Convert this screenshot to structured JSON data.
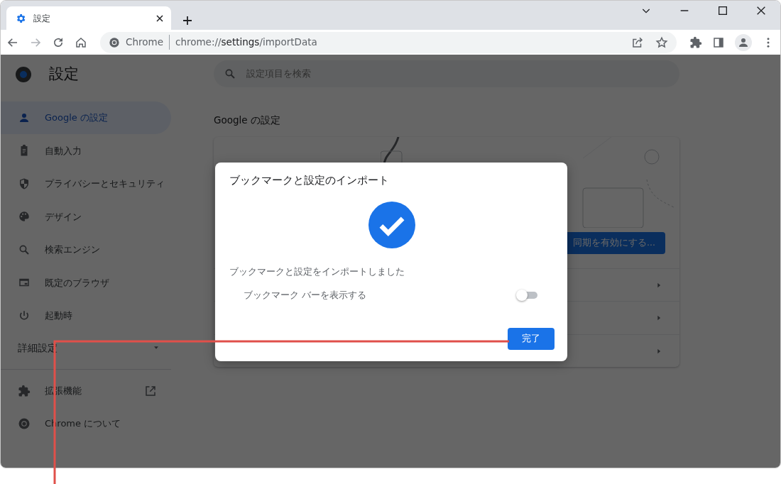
{
  "browser": {
    "tab": {
      "title": "設定",
      "selected": true
    },
    "address": {
      "site": "Chrome",
      "scheme": "chrome://",
      "host": "settings",
      "path": "/importData"
    }
  },
  "sidebar": {
    "title": "設定",
    "items": [
      {
        "label": "Google の設定",
        "selected": true
      },
      {
        "label": "自動入力",
        "selected": false
      },
      {
        "label": "プライバシーとセキュリティ",
        "selected": false
      },
      {
        "label": "デザイン",
        "selected": false
      },
      {
        "label": "検索エンジン",
        "selected": false
      },
      {
        "label": "既定のブラウザ",
        "selected": false
      },
      {
        "label": "起動時",
        "selected": false
      }
    ],
    "advanced": {
      "label": "詳細設定",
      "expanded": false
    },
    "footer_items": [
      {
        "label": "拡張機能"
      },
      {
        "label": "Chrome について"
      }
    ]
  },
  "main": {
    "search": {
      "placeholder": "設定項目を検索"
    },
    "section_title": "Google の設定",
    "sync_button": "同期を有効にする..."
  },
  "dialog": {
    "title": "ブックマークと設定のインポート",
    "message": "ブックマークと設定をインポートしました",
    "toggle": {
      "label": "ブックマーク バーを表示する",
      "on": false
    },
    "done_button": "完了"
  }
}
